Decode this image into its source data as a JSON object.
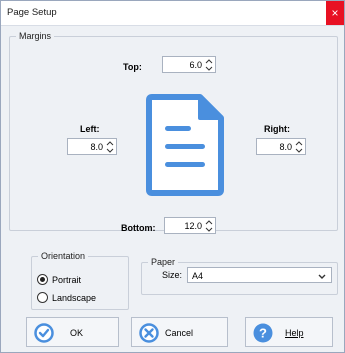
{
  "window": {
    "title": "Page Setup",
    "close_glyph": "×"
  },
  "margins": {
    "legend": "Margins",
    "top_label": "Top:",
    "top_value": "6.0",
    "left_label": "Left:",
    "left_value": "8.0",
    "right_label": "Right:",
    "right_value": "8.0",
    "bottom_label": "Bottom:",
    "bottom_value": "12.0",
    "preview_icon": "page-document-icon"
  },
  "orientation": {
    "legend": "Orientation",
    "portrait_label": "Portrait",
    "landscape_label": "Landscape",
    "selected": "Portrait"
  },
  "paper": {
    "legend": "Paper",
    "size_label": "Size:",
    "size_value": "A4"
  },
  "buttons": {
    "ok_label": "OK",
    "cancel_label": "Cancel",
    "help_label": "Help"
  },
  "colors": {
    "accent": "#4a8fde",
    "close": "#e81123"
  }
}
